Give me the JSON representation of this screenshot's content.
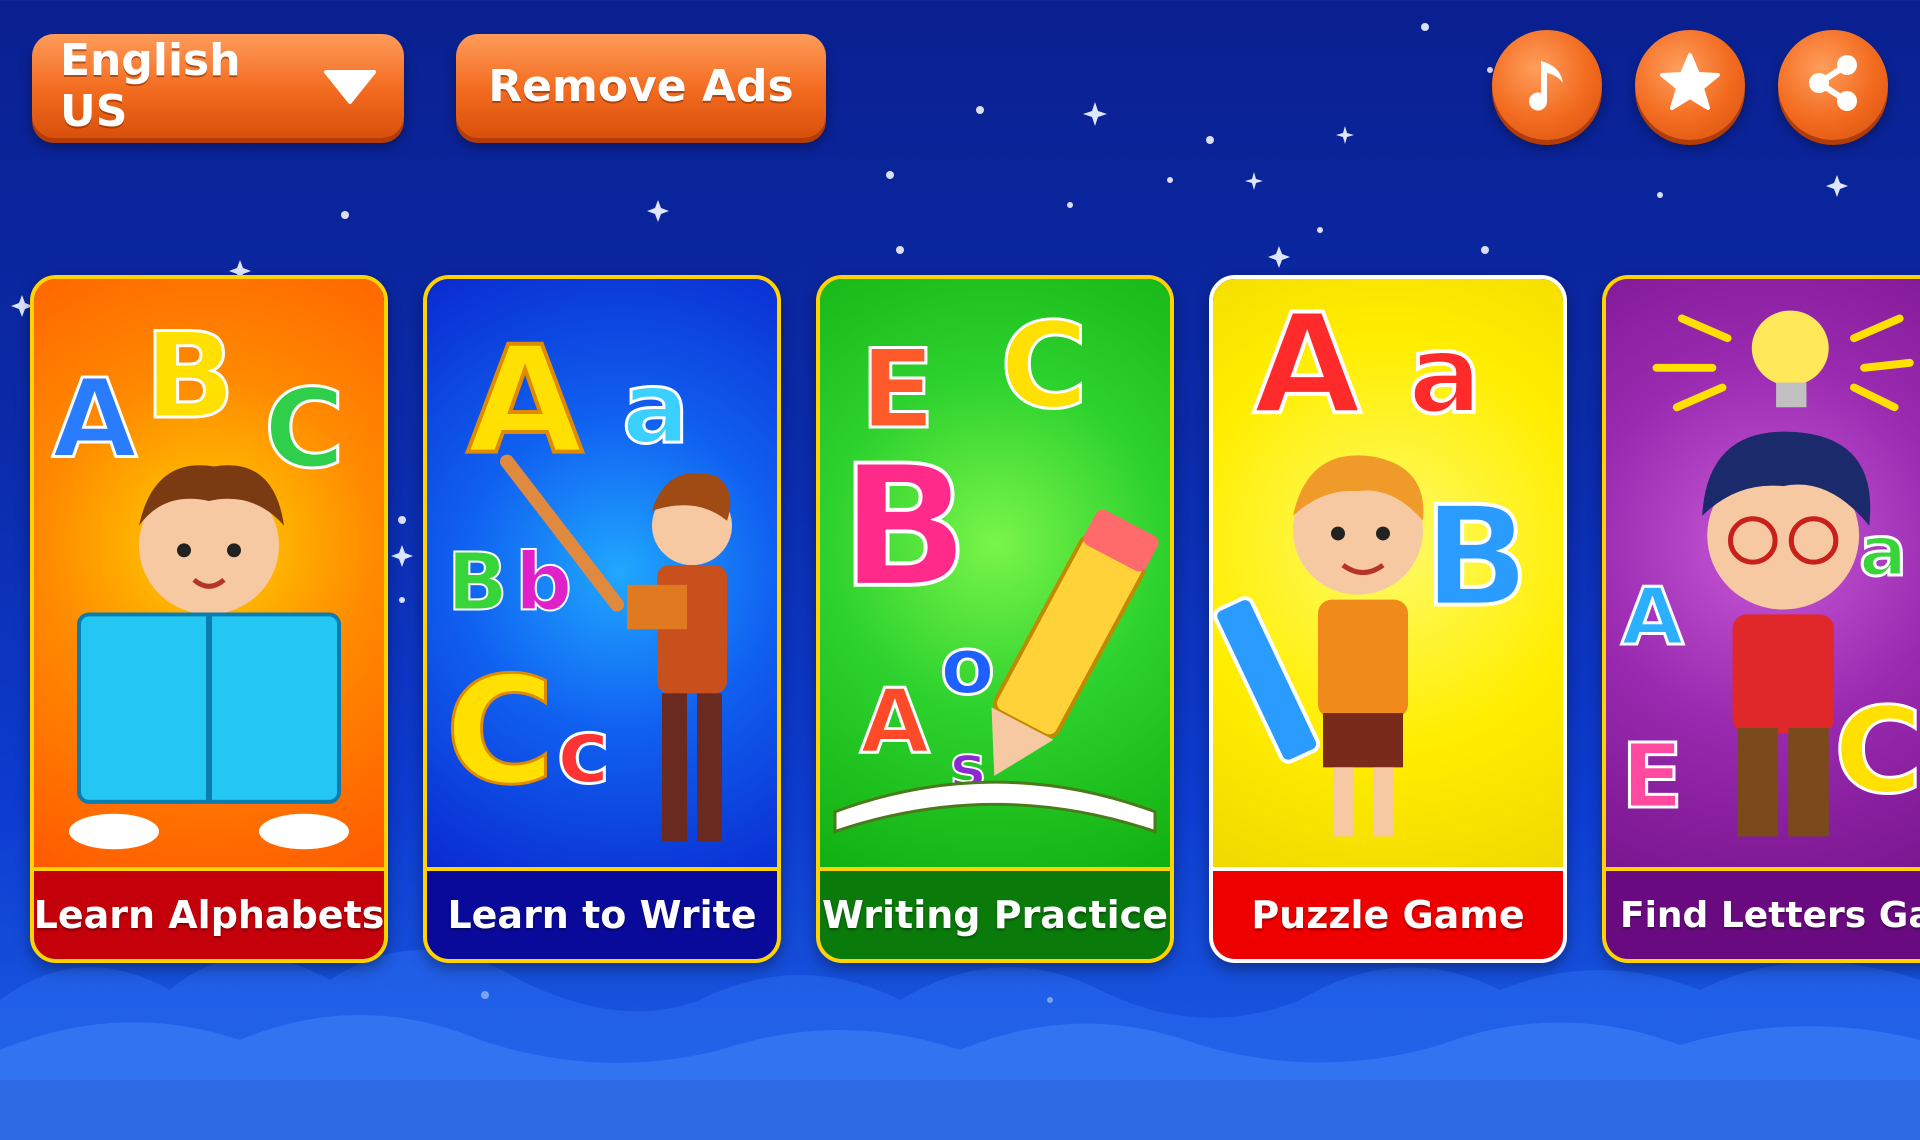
{
  "header": {
    "language": {
      "label": "English US",
      "icon": "chevron-down-icon"
    },
    "remove_ads": {
      "label": "Remove Ads"
    },
    "actions": [
      {
        "name": "music-button",
        "icon": "music-note-icon"
      },
      {
        "name": "rate-button",
        "icon": "star-icon"
      },
      {
        "name": "share-button",
        "icon": "share-icon"
      }
    ]
  },
  "cards": [
    {
      "label": "Learn Alphabets",
      "bg": "#ff6a00",
      "label_bg": "#c4000a",
      "art_letters": "ABC"
    },
    {
      "label": "Learn to Write",
      "bg": "#1030e0",
      "label_bg": "#0a0a9a",
      "art_letters": "AaBbCc"
    },
    {
      "label": "Writing Practice",
      "bg": "#22cc22",
      "label_bg": "#0a7a0a",
      "art_letters": "ECBAoAs"
    },
    {
      "label": "Puzzle Game",
      "bg": "#ffee00",
      "label_bg": "#ee0000",
      "art_letters": "AaBI"
    },
    {
      "label": "Find Letters Gam",
      "bg": "#8a1fa0",
      "label_bg": "#6a0a80",
      "art_letters": "AaEC"
    }
  ],
  "colors": {
    "button_orange": "#f26a1e",
    "card_border": "#ffd200"
  }
}
